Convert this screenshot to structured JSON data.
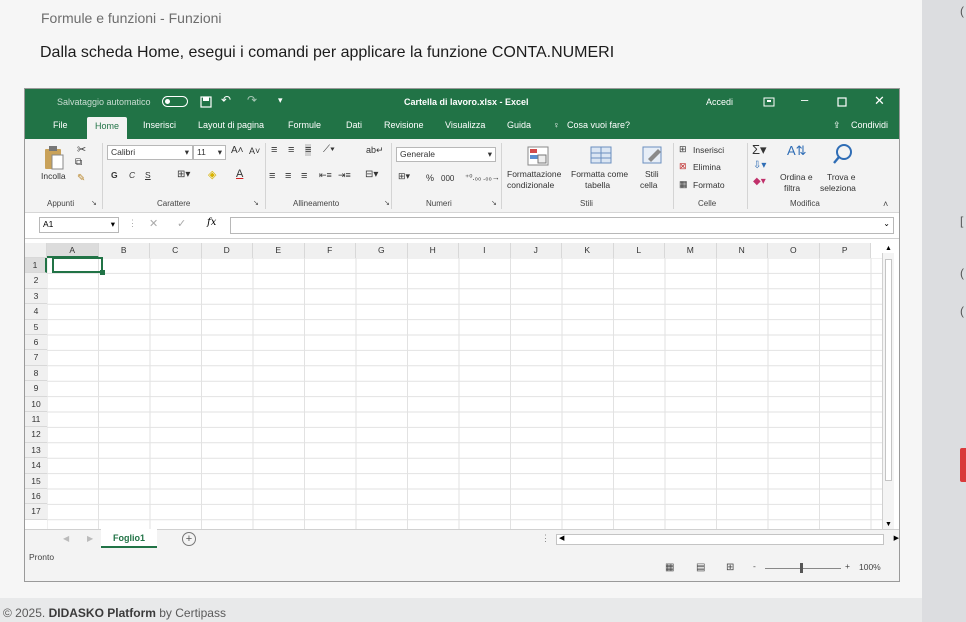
{
  "course": {
    "breadcrumb": "Formule e funzioni - Funzioni",
    "instruction": "Dalla scheda Home, esegui i comandi per applicare la funzione CONTA.NUMERI"
  },
  "footer": {
    "copyright": "© 2025.",
    "brand": "DIDASKO Platform",
    "by": "by Certipass"
  },
  "excel": {
    "title": {
      "autosave": "Salvataggio automatico",
      "doc_title": "Cartella di lavoro.xlsx - Excel",
      "signin": "Accedi"
    },
    "tabs": [
      "File",
      "Home",
      "Inserisci",
      "Layout di pagina",
      "Formule",
      "Dati",
      "Revisione",
      "Visualizza",
      "Guida"
    ],
    "tell_me": "Cosa vuoi fare?",
    "share": "Condividi",
    "ribbon": {
      "paste": "Incolla",
      "font_name": "Calibri",
      "font_size": "11",
      "bold": "G",
      "italic": "C",
      "underline": "S",
      "number_format": "Generale",
      "percent": "%",
      "thousands": "000",
      "cond_format_1": "Formattazione",
      "cond_format_2": "condizionale",
      "format_table_1": "Formatta come",
      "format_table_2": "tabella",
      "cell_styles_1": "Stili",
      "cell_styles_2": "cella",
      "insert": "Inserisci",
      "delete": "Elimina",
      "format": "Formato",
      "sort_1": "Ordina e",
      "sort_2": "filtra",
      "find_1": "Trova e",
      "find_2": "seleziona",
      "groups": {
        "clipboard": "Appunti",
        "font": "Carattere",
        "alignment": "Allineamento",
        "number": "Numeri",
        "styles": "Stili",
        "cells": "Celle",
        "editing": "Modifica"
      }
    },
    "name_box": "A1",
    "fx": "fx",
    "columns": [
      "A",
      "B",
      "C",
      "D",
      "E",
      "F",
      "G",
      "H",
      "I",
      "J",
      "K",
      "L",
      "M",
      "N",
      "O",
      "P"
    ],
    "rows": [
      "1",
      "2",
      "3",
      "4",
      "5",
      "6",
      "7",
      "8",
      "9",
      "10",
      "11",
      "12",
      "13",
      "14",
      "15",
      "16",
      "17"
    ],
    "sheet_tab": "Foglio1",
    "add_sheet": "+",
    "status": "Pronto",
    "zoom": "100%",
    "zoom_minus": "-",
    "zoom_plus": "+",
    "accent": "#217346"
  }
}
